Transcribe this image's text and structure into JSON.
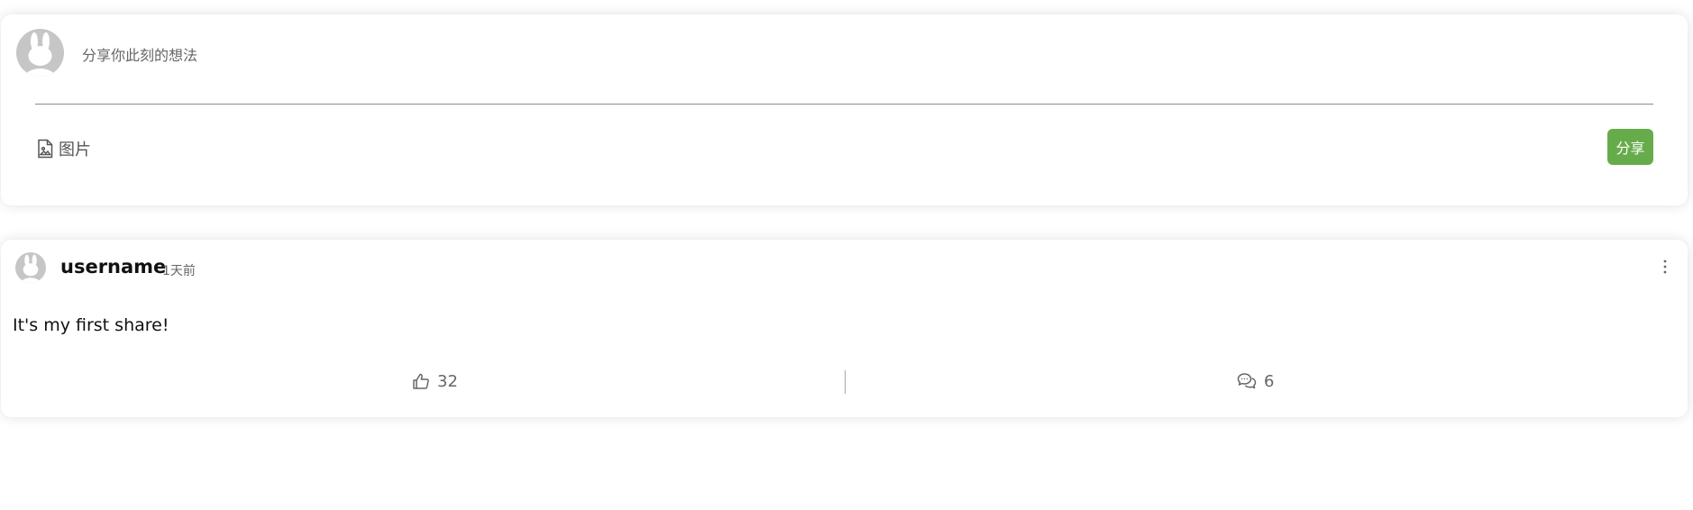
{
  "composer": {
    "placeholder": "分享你此刻的想法",
    "image_label": "图片",
    "submit_label": "分享",
    "accent_color": "#67ac4b"
  },
  "post": {
    "username": "username",
    "time": "1天前",
    "content": "It's my first share!",
    "likes": "32",
    "comments": "6",
    "icons": {
      "avatar": "rabbit-avatar-icon",
      "more": "more-vertical-icon",
      "like": "thumbs-up-icon",
      "comment": "chat-bubbles-icon",
      "image": "image-file-icon"
    }
  }
}
